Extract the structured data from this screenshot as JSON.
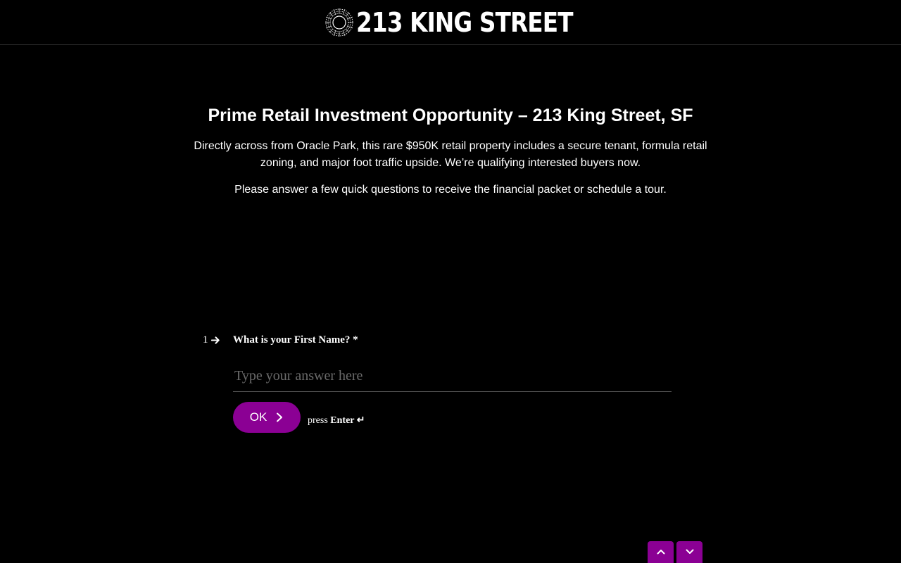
{
  "header": {
    "brand": "213 KING STREET",
    "logo_icon": "starburst-logo-icon"
  },
  "intro": {
    "title": "Prime Retail Investment Opportunity – 213 King Street, SF",
    "description": "Directly across from Oracle Park, this rare $950K retail property includes a secure tenant, formula retail zoning, and major foot traffic upside. We’re qualifying interested buyers now.",
    "instruction": "Please answer a few quick questions to receive the financial packet or schedule a tour."
  },
  "question": {
    "number": "1",
    "label": "What is your First Name? *",
    "answer_value": "",
    "placeholder": "Type your answer here",
    "ok_label": "OK",
    "hint_prefix": "press",
    "hint_key": "Enter ↵"
  },
  "navigation": {
    "up_icon": "chevron-up-icon",
    "down_icon": "chevron-down-icon"
  },
  "colors": {
    "accent": "#8b0094",
    "background": "#000000",
    "text": "#ffffff"
  }
}
